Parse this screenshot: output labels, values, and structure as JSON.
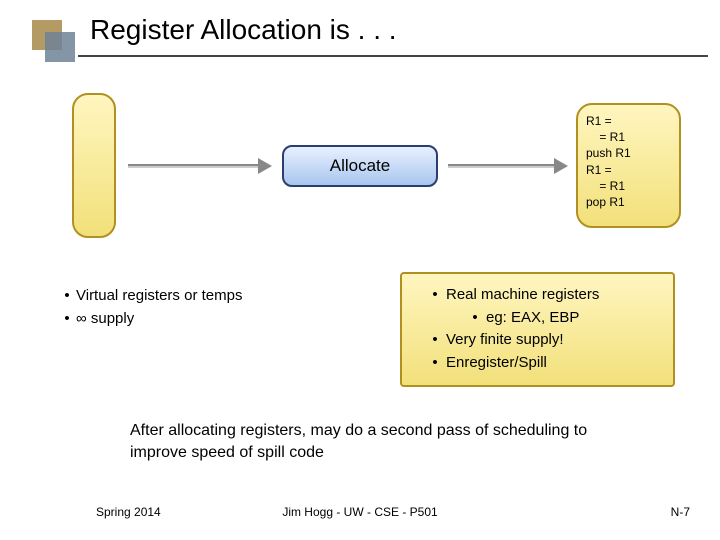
{
  "title": "Register Allocation is . . .",
  "allocateLabel": "Allocate",
  "codeBox": "R1 =\n    = R1\npush R1\nR1 =\n    = R1\npop R1",
  "leftBullets": {
    "item1": "Virtual registers or temps",
    "item2": "∞ supply"
  },
  "rightBullets": {
    "item1": "Real machine registers",
    "item1sub": "eg: EAX, EBP",
    "item2": "Very finite supply!",
    "item3": "Enregister/Spill"
  },
  "bottomNote": "After allocating registers, may do a second pass of scheduling to improve speed of spill code",
  "footer": {
    "left": "Spring 2014",
    "center": "Jim Hogg - UW - CSE - P501",
    "right": "N-7"
  }
}
